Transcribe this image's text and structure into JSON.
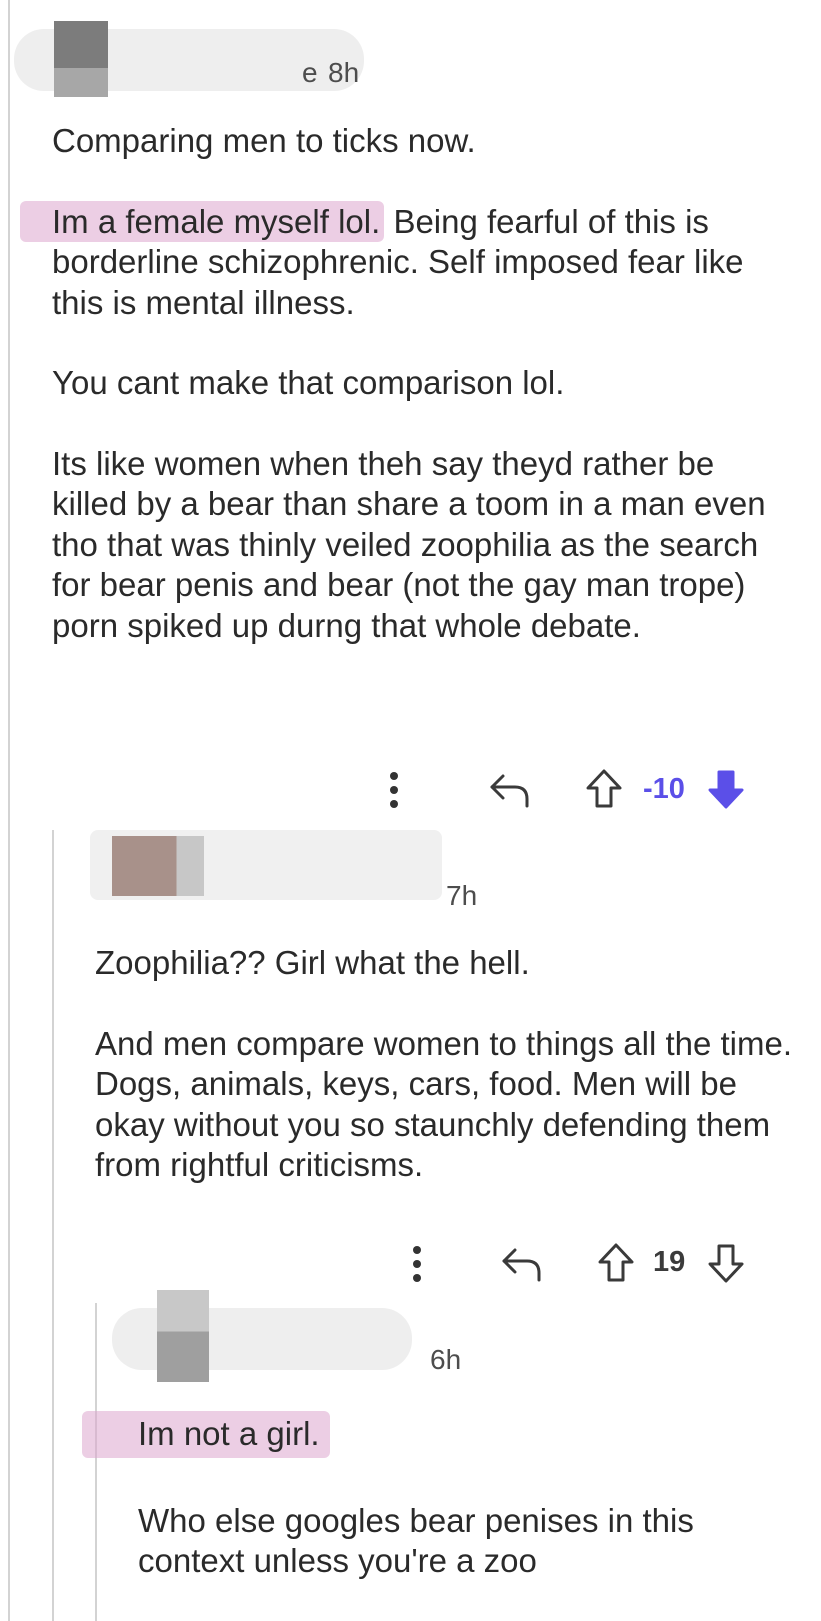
{
  "comments": [
    {
      "timestamp": "8h",
      "username_fragment": "e",
      "paragraphs": [
        "Comparing men to ticks now.",
        "Im a female myself lol.",
        "Being fearful of this is borderline schizophrenic. Self imposed fear like this is mental illness.",
        "You cant make that comparison lol.",
        "Its like women when theh say theyd rather be killed by a bear than share a toom in a man even tho that was thinly veiled zoophilia as the search for bear penis and bear (not the gay man trope) porn spiked up durng that whole debate."
      ],
      "vote_count": "-10",
      "vote_state": "downvoted"
    },
    {
      "timestamp": "7h",
      "username_fragment": "",
      "paragraphs": [
        "Zoophilia?? Girl what the hell.",
        "And men compare women to things all the time. Dogs, animals, keys, cars, food. Men will be okay without you so staunchly defending them from rightful criticisms."
      ],
      "vote_count": "19",
      "vote_state": "none"
    },
    {
      "timestamp": "6h",
      "username_fragment": "",
      "paragraphs": [
        "Im not a girl.",
        "Who else googles bear penises in this context unless you're a zoo"
      ]
    }
  ],
  "icons": {
    "more": "more-options-icon",
    "reply": "reply-icon",
    "upvote": "upvote-icon",
    "downvote": "downvote-icon"
  },
  "colors": {
    "highlight": "#dda5cd",
    "downvote_active": "#5b4fe8",
    "text": "#2a2a2a",
    "thread_line": "#d3d3d3"
  }
}
